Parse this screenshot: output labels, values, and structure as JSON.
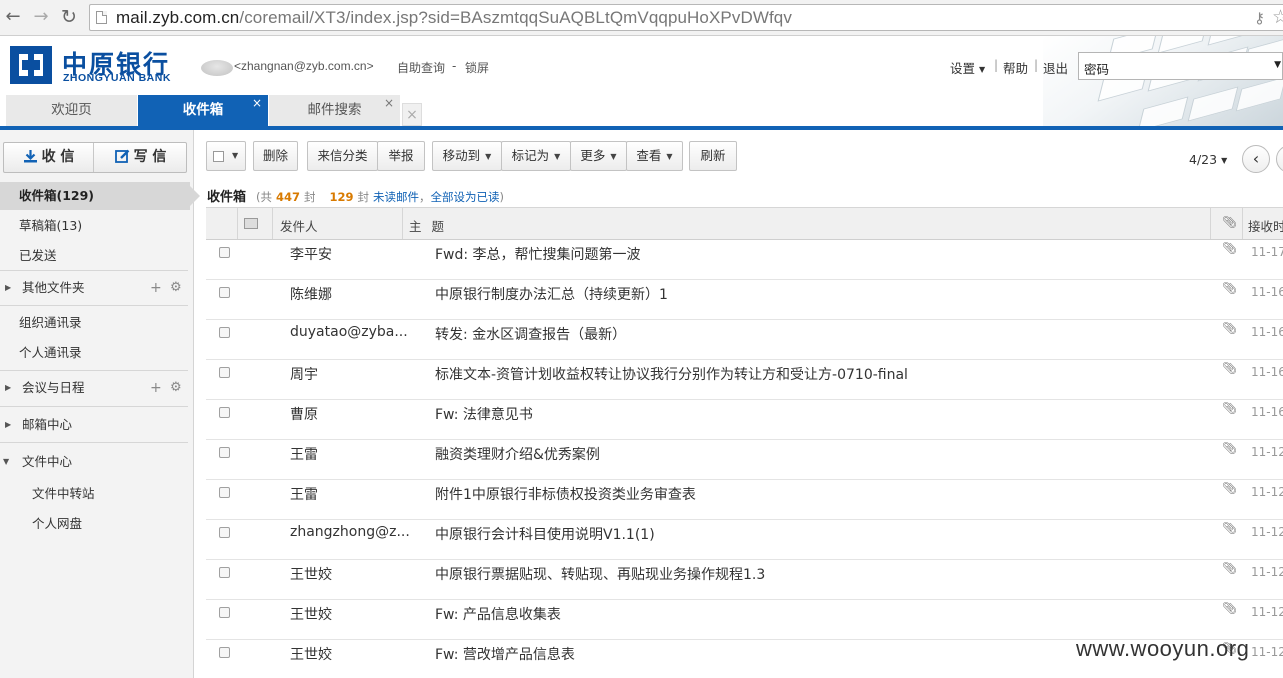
{
  "browser": {
    "url_host": "mail.zyb.com.cn",
    "url_rest": "/coremail/XT3/index.jsp?sid=BAszmtqqSuAQBLtQmVqqpuHoXPvDWfqv"
  },
  "header": {
    "logo_cn": "中原银行",
    "logo_en": "ZHONGYUAN BANK",
    "user_email": "<zhangnan@zyb.com.cn>",
    "self_query": "自助查询",
    "dash": "-",
    "lock_screen": "锁屏",
    "settings": "设置",
    "help": "帮助",
    "logout": "退出",
    "separator": "|",
    "password_select": "密码"
  },
  "tabs": [
    {
      "label": "欢迎页"
    },
    {
      "label": "收件箱"
    },
    {
      "label": "邮件搜索"
    }
  ],
  "sidebar": {
    "receive": "收 信",
    "compose": "写 信",
    "inbox": "收件箱(129)",
    "drafts": "草稿箱(13)",
    "sent": "已发送",
    "other_folders": "其他文件夹",
    "contacts_org": "组织通讯录",
    "contacts_personal": "个人通讯录",
    "meeting": "会议与日程",
    "mailbox_center": "邮箱中心",
    "file_center": "文件中心",
    "file_transfer": "文件中转站",
    "netdisk": "个人网盘"
  },
  "toolbar": {
    "delete": "删除",
    "classify": "来信分类",
    "report": "举报",
    "move": "移动到",
    "mark": "标记为",
    "more": "更多",
    "view": "查看",
    "refresh": "刷新",
    "pager": "4/23"
  },
  "summary": {
    "title": "收件箱",
    "total_pre": "(共",
    "total": "447",
    "total_post": "封",
    "unread": "129",
    "unread_post": "封",
    "unread_link": "未读邮件",
    "sep": "，",
    "mark_all": "全部设为已读",
    "close": ")"
  },
  "table": {
    "col_sender": "发件人",
    "col_subject": "主题",
    "col_time": "接收时",
    "rows": [
      {
        "sender": "李平安",
        "subject": "Fwd: 李总，帮忙搜集问题第一波",
        "time": "11-17"
      },
      {
        "sender": "陈维娜",
        "subject": "中原银行制度办法汇总（持续更新）1",
        "time": "11-16"
      },
      {
        "sender": "duyatao@zyba...",
        "subject": "转发: 金水区调查报告（最新）",
        "time": "11-16"
      },
      {
        "sender": "周宇",
        "subject": "标准文本-资管计划收益权转让协议我行分别作为转让方和受让方-0710-final",
        "time": "11-16"
      },
      {
        "sender": "曹原",
        "subject": "Fw: 法律意见书",
        "time": "11-16"
      },
      {
        "sender": "王雷",
        "subject": "融资类理财介绍&优秀案例",
        "time": "11-12"
      },
      {
        "sender": "王雷",
        "subject": "附件1中原银行非标债权投资类业务审查表",
        "time": "11-12"
      },
      {
        "sender": "zhangzhong@z...",
        "subject": "中原银行会计科目使用说明V1.1(1)",
        "time": "11-12"
      },
      {
        "sender": "王世姣",
        "subject": "中原银行票据贴现、转贴现、再贴现业务操作规程1.3",
        "time": "11-12"
      },
      {
        "sender": "王世姣",
        "subject": "Fw: 产品信息收集表",
        "time": "11-12"
      },
      {
        "sender": "王世姣",
        "subject": "Fw: 营改增产品信息表",
        "time": "11-12"
      }
    ]
  },
  "watermark": "www.wooyun.org"
}
